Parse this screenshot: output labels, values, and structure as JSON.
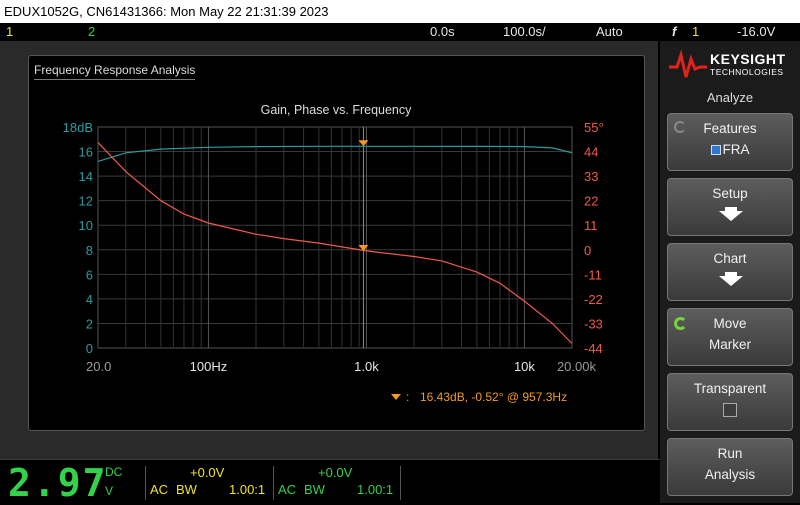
{
  "title_bar": "EDUX1052G, CN61431366: Mon May 22 21:31:39 2023",
  "status": {
    "ch1": "1",
    "ch2": "2",
    "time_pos": "0.0s",
    "time_scale": "100.0s/",
    "trigger_mode": "Auto",
    "trig_icon": "f",
    "trig_channel": "1",
    "trig_level": "-16.0V"
  },
  "fra": {
    "window_title": "Frequency Response Analysis",
    "marker_readout": "16.43dB, -0.52° @ 957.3Hz"
  },
  "chart_data": {
    "type": "line",
    "title": "Gain, Phase vs. Frequency",
    "x_scale": "log",
    "xlim": [
      20,
      20000
    ],
    "x_tick_labels": [
      "20.0",
      "100Hz",
      "1.0k",
      "10k",
      "20.00k"
    ],
    "left_axis": {
      "ylim": [
        0,
        18
      ],
      "tick_labels": [
        "18dB",
        "16",
        "14",
        "12",
        "10",
        "8",
        "6",
        "4",
        "2",
        "0"
      ],
      "color": "#2a9ca0"
    },
    "right_axis": {
      "ylim": [
        -44,
        55
      ],
      "tick_labels": [
        "55°",
        "44",
        "33",
        "22",
        "11",
        "0",
        "-11",
        "-22",
        "-33",
        "-44"
      ],
      "color": "#f05a4a"
    },
    "series": [
      {
        "color": "#2a9ca0",
        "axis": "left",
        "x": [
          20,
          30,
          50,
          100,
          200,
          500,
          1000,
          2000,
          5000,
          10000,
          15000,
          20000
        ],
        "y": [
          15.2,
          15.9,
          16.2,
          16.35,
          16.4,
          16.43,
          16.43,
          16.43,
          16.42,
          16.4,
          16.3,
          15.9
        ]
      },
      {
        "color": "#f05a4a",
        "axis": "left_phase_in_degrees",
        "x": [
          20,
          30,
          50,
          70,
          100,
          200,
          300,
          500,
          1000,
          2000,
          3000,
          5000,
          7000,
          10000,
          15000,
          20000
        ],
        "y": [
          48,
          35,
          22,
          16,
          12,
          7,
          5,
          3,
          -0.5,
          -3,
          -5,
          -10,
          -15,
          -23,
          -33,
          -42
        ]
      }
    ],
    "marker": {
      "x": 957.3,
      "gain_db": 16.43,
      "phase_deg": -0.52
    }
  },
  "side": {
    "brand1": "KEYSIGHT",
    "brand2": "TECHNOLOGIES",
    "menu_title": "Analyze",
    "features_label": "Features",
    "features_value": "FRA",
    "setup_label": "Setup",
    "chart_label": "Chart",
    "move_label1": "Move",
    "move_label2": "Marker",
    "transparent_label": "Transparent",
    "run_label1": "Run",
    "run_label2": "Analysis"
  },
  "bottom": {
    "digits": "2.97",
    "dc": "DC",
    "unit": "V",
    "ch1_offset": "+0.0V",
    "ch1_coupling": "AC",
    "ch1_bw": "BW",
    "ch1_probe": "1.00:1",
    "ch2_offset": "+0.0V",
    "ch2_coupling": "AC",
    "ch2_bw": "BW",
    "ch2_probe": "1.00:1"
  }
}
